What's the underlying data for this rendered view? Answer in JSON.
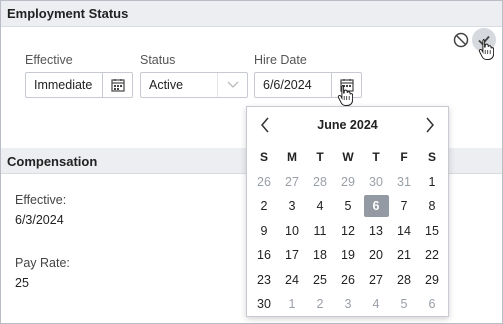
{
  "employment": {
    "title": "Employment Status",
    "effective_label": "Effective",
    "effective_value": "Immediate",
    "status_label": "Status",
    "status_value": "Active",
    "hire_label": "Hire Date",
    "hire_value": "6/6/2024"
  },
  "compensation": {
    "title": "Compensation",
    "effective_label": "Effective:",
    "effective_value": "6/3/2024",
    "payrate_label": "Pay Rate:",
    "payrate_value": "25"
  },
  "icons": {
    "cancel": "cancel-icon",
    "confirm": "check-icon",
    "calendar": "calendar-icon",
    "chevron": "chevron-down-icon",
    "pointer": "hand-pointer-icon"
  },
  "datepicker": {
    "month_label": "June 2024",
    "weekdays": [
      "S",
      "M",
      "T",
      "W",
      "T",
      "F",
      "S"
    ],
    "weeks": [
      [
        {
          "d": "26",
          "o": true
        },
        {
          "d": "27",
          "o": true
        },
        {
          "d": "28",
          "o": true
        },
        {
          "d": "29",
          "o": true
        },
        {
          "d": "30",
          "o": true
        },
        {
          "d": "31",
          "o": true
        },
        {
          "d": "1"
        }
      ],
      [
        {
          "d": "2"
        },
        {
          "d": "3"
        },
        {
          "d": "4"
        },
        {
          "d": "5"
        },
        {
          "d": "6",
          "sel": true
        },
        {
          "d": "7"
        },
        {
          "d": "8"
        }
      ],
      [
        {
          "d": "9"
        },
        {
          "d": "10"
        },
        {
          "d": "11"
        },
        {
          "d": "12"
        },
        {
          "d": "13"
        },
        {
          "d": "14"
        },
        {
          "d": "15"
        }
      ],
      [
        {
          "d": "16"
        },
        {
          "d": "17"
        },
        {
          "d": "18"
        },
        {
          "d": "19"
        },
        {
          "d": "20"
        },
        {
          "d": "21"
        },
        {
          "d": "22"
        }
      ],
      [
        {
          "d": "23"
        },
        {
          "d": "24"
        },
        {
          "d": "25"
        },
        {
          "d": "26"
        },
        {
          "d": "27"
        },
        {
          "d": "28"
        },
        {
          "d": "29"
        }
      ],
      [
        {
          "d": "30"
        },
        {
          "d": "1",
          "o": true
        },
        {
          "d": "2",
          "o": true
        },
        {
          "d": "3",
          "o": true
        },
        {
          "d": "4",
          "o": true
        },
        {
          "d": "5",
          "o": true
        },
        {
          "d": "6",
          "o": true
        }
      ]
    ]
  },
  "colors": {
    "header_bg": "#eceef2",
    "selected_day_bg": "#949aa3",
    "other_month_text": "#9aa0a8"
  }
}
